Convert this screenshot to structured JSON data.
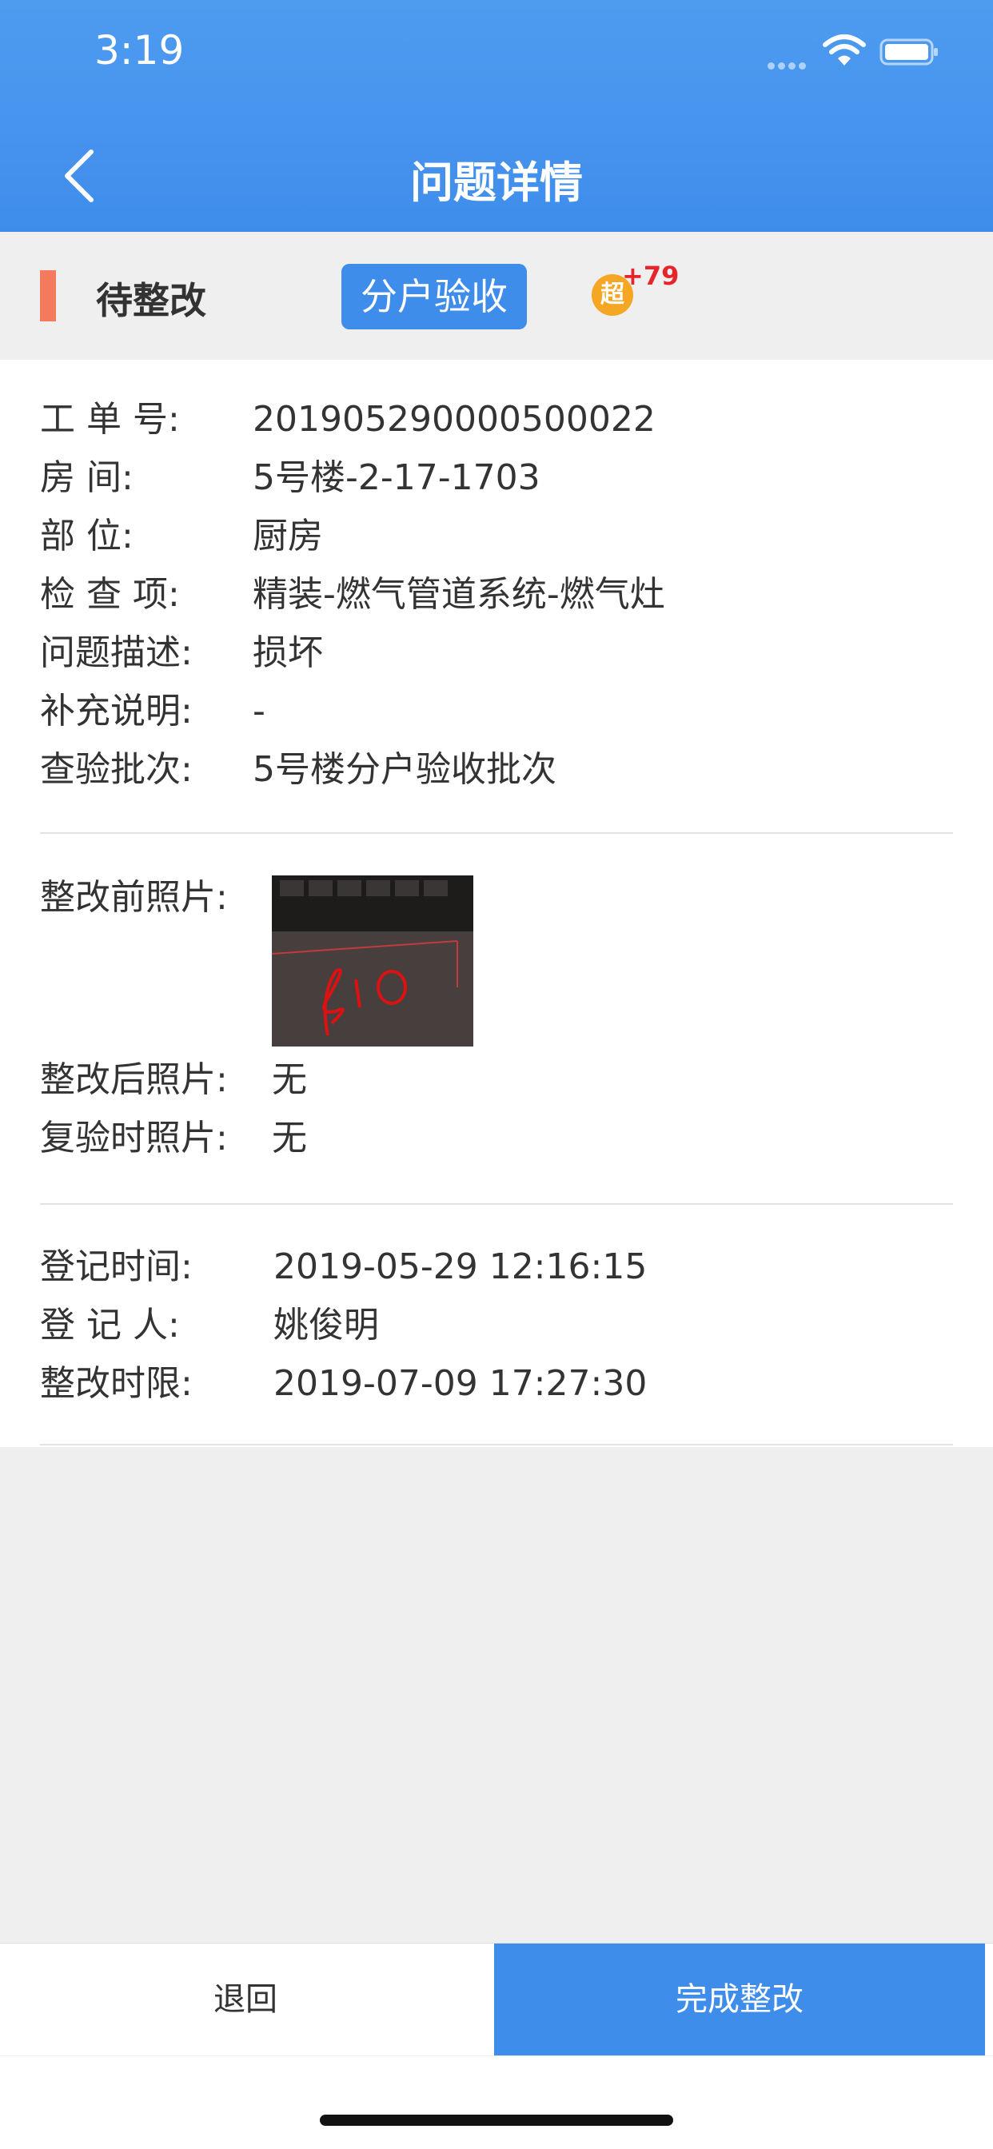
{
  "status_bar": {
    "time": "3:19"
  },
  "header": {
    "title": "问题详情"
  },
  "issue_status": {
    "label": "待整改",
    "tag": "分户验收",
    "badge_icon": "超",
    "badge_count": "+79"
  },
  "details": [
    {
      "label": "工 单 号:",
      "value": "201905290000500022"
    },
    {
      "label": "房      间:",
      "value": "5号楼-2-17-1703"
    },
    {
      "label": "部      位:",
      "value": "厨房"
    },
    {
      "label": "检 查 项:",
      "value": "精装-燃气管道系统-燃气灶"
    },
    {
      "label": "问题描述:",
      "value": "损坏"
    },
    {
      "label": "补充说明:",
      "value": "-"
    },
    {
      "label": "查验批次:",
      "value": "5号楼分户验收批次"
    }
  ],
  "photos": [
    {
      "label": "整改前照片:",
      "value": ""
    },
    {
      "label": "整改后照片:",
      "value": "无"
    },
    {
      "label": "复验时照片:",
      "value": "无"
    }
  ],
  "records": [
    {
      "label": "登记时间:",
      "value": "2019-05-29 12:16:15"
    },
    {
      "label": "登 记 人:",
      "value": "姚俊明"
    },
    {
      "label": "整改时限:",
      "value": "2019-07-09 17:27:30"
    }
  ],
  "actions": {
    "back_label": "退回",
    "done_label": "完成整改"
  },
  "colors": {
    "primary": "#3f8deb",
    "status_indicator": "#f47a5d",
    "badge_count": "#e8242b"
  }
}
